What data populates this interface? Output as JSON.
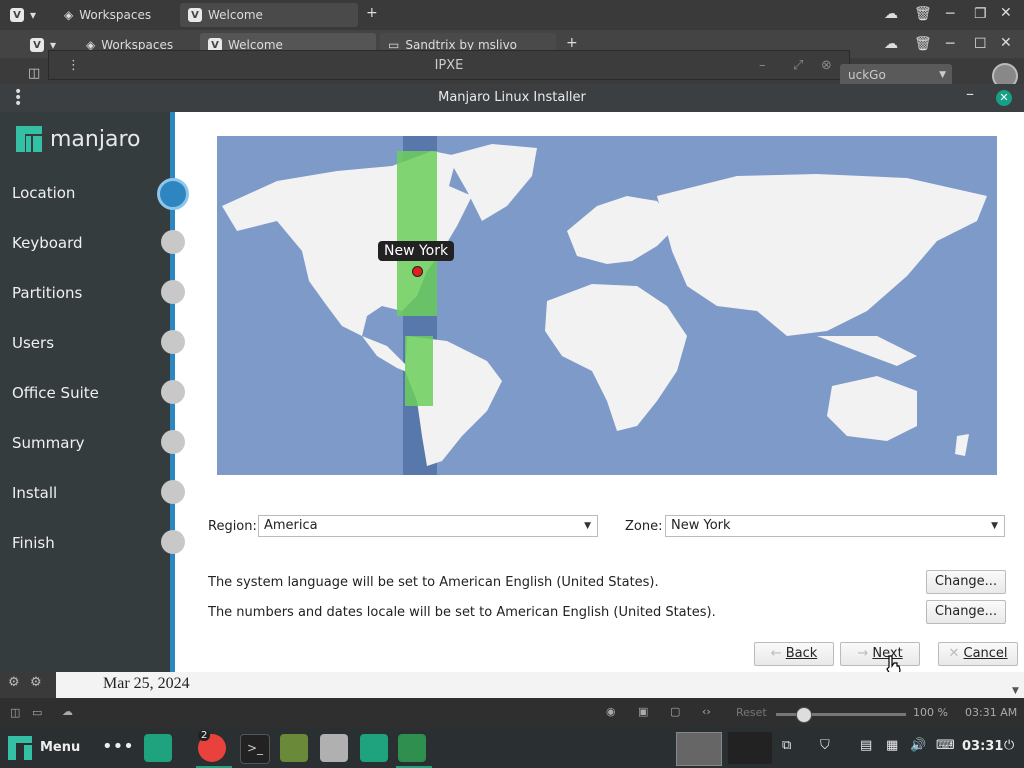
{
  "browser": {
    "tab_workspaces": "Workspaces",
    "tab_welcome": "Welcome",
    "tab_sandtrix": "Sandtrix by mslivo",
    "vm_window_title": "IPXE",
    "search_engine": "uckGo"
  },
  "installer": {
    "title": "Manjaro Linux Installer",
    "logo": "manjaro",
    "steps": [
      {
        "label": "Location"
      },
      {
        "label": "Keyboard"
      },
      {
        "label": "Partitions"
      },
      {
        "label": "Users"
      },
      {
        "label": "Office Suite"
      },
      {
        "label": "Summary"
      },
      {
        "label": "Install"
      },
      {
        "label": "Finish"
      }
    ],
    "active_step": "Location",
    "map_label": "New York",
    "region_label": "Region:",
    "region_value": "America",
    "zone_label": "Zone:",
    "zone_value": "New York",
    "language_text": "The system language will be set to American English (United States).",
    "locale_text": "The numbers and dates locale will be set to American English (United States).",
    "change_label": "Change...",
    "back_label": "Back",
    "next_label": "Next",
    "cancel_label": "Cancel"
  },
  "background": {
    "date_text": "Mar 25, 2024",
    "reset_label": "Reset",
    "zoom": "100 %",
    "clock_status": "03:31 AM"
  },
  "taskbar": {
    "menu_label": "Menu",
    "badge_count": "2",
    "clock": "03:31"
  },
  "colors": {
    "accent": "#2e86c1",
    "manjaro_green": "#35bfa4",
    "sidebar": "#353c3e"
  }
}
